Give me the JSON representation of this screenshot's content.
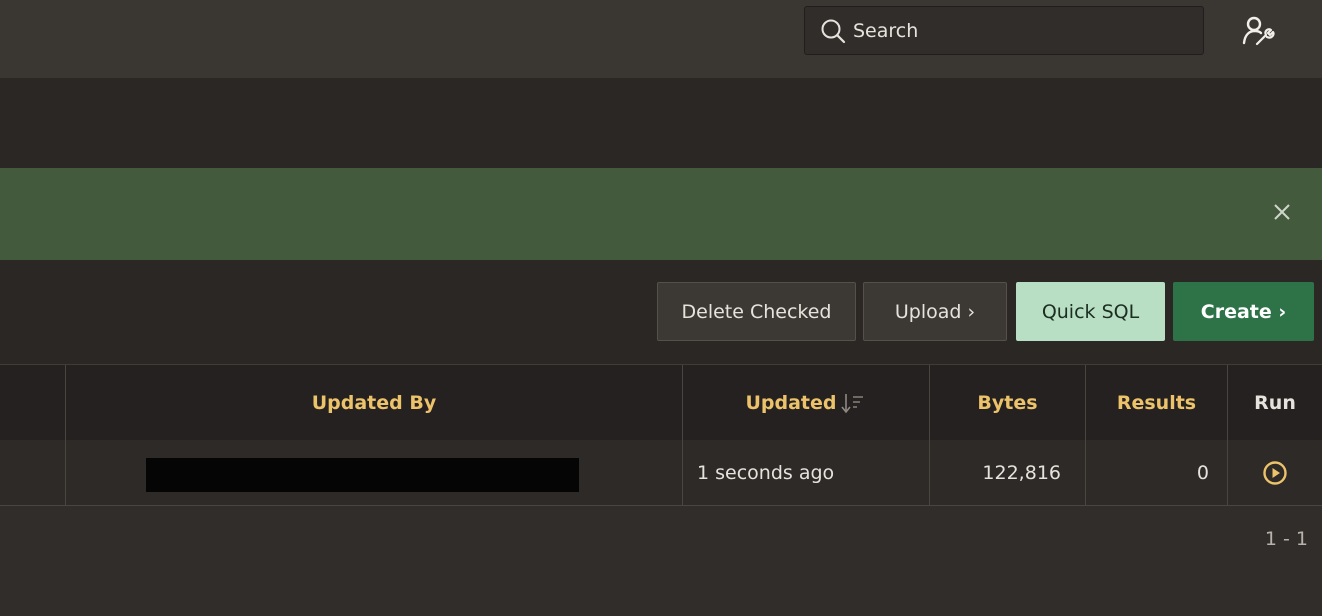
{
  "header": {
    "search_placeholder": "Search",
    "user_icon": "user-wrench-icon"
  },
  "alert": {
    "close_icon": "close-icon"
  },
  "toolbar": {
    "delete_label": "Delete Checked",
    "upload_label": "Upload ›",
    "quick_sql_label": "Quick SQL",
    "create_label": "Create ›"
  },
  "table": {
    "columns": [
      "Updated By",
      "Updated",
      "Bytes",
      "Results",
      "Run"
    ],
    "sort_icon": "sort-desc-icon",
    "rows": [
      {
        "updated_by": "",
        "updated": "1 seconds ago",
        "bytes": "122,816",
        "results": "0",
        "run_icon": "play-circle-icon"
      }
    ],
    "pagination": "1 - 1"
  },
  "colors": {
    "accent_header": "#ecc26a",
    "alert_bg": "#435a3d",
    "create_bg": "#2e7348",
    "quick_sql_bg": "#b8dfc3"
  }
}
